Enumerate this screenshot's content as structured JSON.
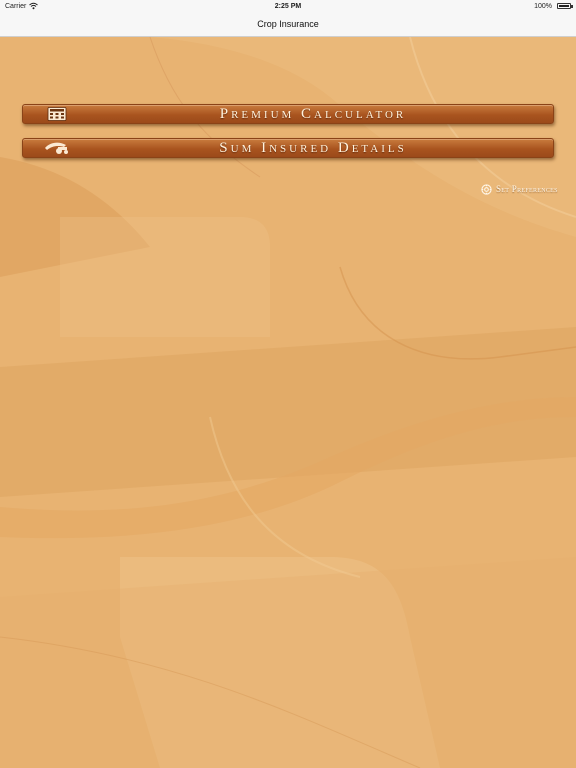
{
  "status_bar": {
    "carrier": "Carrier",
    "time": "2:25 PM",
    "battery": "100%",
    "icons": [
      "wifi-icon",
      "battery-icon"
    ]
  },
  "nav_bar": {
    "title": "Crop Insurance"
  },
  "menu": {
    "premium_calculator": {
      "label": "Premium Calculator",
      "icon": "calculator-icon"
    },
    "sum_insured": {
      "label": "Sum Insured Details",
      "icon": "tractor-icon"
    }
  },
  "preferences": {
    "label": "Set Preferences",
    "icon": "gear-icon"
  },
  "colors": {
    "background": "#e8b372",
    "button": "#a9541f",
    "button_text": "#fff3df"
  }
}
